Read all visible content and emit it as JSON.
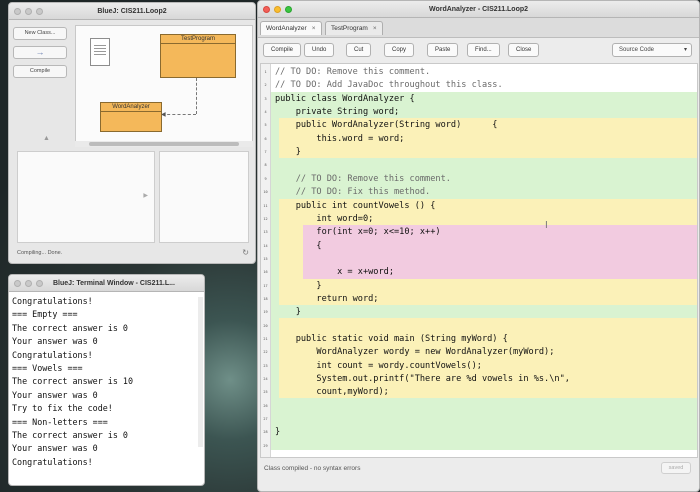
{
  "bluej": {
    "title": "BlueJ: CIS211.Loop2",
    "new_class": "New Class...",
    "arrow_symbol": "→",
    "compile": "Compile",
    "classes": [
      "TestProgram",
      "WordAnalyzer"
    ],
    "status": "Compiling... Done."
  },
  "terminal": {
    "title": "BlueJ: Terminal Window - CIS211.L...",
    "lines": [
      "Congratulations!",
      "=== Empty ===",
      "The correct answer is 0",
      "Your answer was 0",
      "Congratulations!",
      "=== Vowels ===",
      "The correct answer is 10",
      "Your answer was 0",
      "Try to fix the code!",
      "=== Non-letters ===",
      "The correct answer is 0",
      "Your answer was 0",
      "Congratulations!"
    ]
  },
  "editor": {
    "title": "WordAnalyzer - CIS211.Loop2",
    "tabs": [
      "WordAnalyzer",
      "TestProgram"
    ],
    "toolbar": {
      "compile": "Compile",
      "undo": "Undo",
      "cut": "Cut",
      "copy": "Copy",
      "paste": "Paste",
      "find": "Find...",
      "close": "Close",
      "view": "Source Code"
    },
    "code_lines": [
      "// TO DO: Remove this comment.",
      "// TO DO: Add JavaDoc throughout this class.",
      "public class WordAnalyzer {",
      "    private String word;",
      "    public WordAnalyzer(String word)      {",
      "        this.word = word;",
      "    }",
      "",
      "    // TO DO: Remove this comment.",
      "    // TO DO: Fix this method.",
      "    public int countVowels () {",
      "        int word=0;",
      "        for(int x=0; x<=10; x++)",
      "        {",
      "",
      "            x = x+word;",
      "        }",
      "        return word;",
      "    }",
      "",
      "    public static void main (String myWord) {",
      "        WordAnalyzer wordy = new WordAnalyzer(myWord);",
      "        int count = wordy.countVowels();",
      "        System.out.printf(\"There are %d vowels in %s.\\n\",",
      "        count,myWord);",
      "",
      "",
      "}",
      ""
    ],
    "status": "Class compiled - no syntax errors",
    "saved": "saved"
  }
}
